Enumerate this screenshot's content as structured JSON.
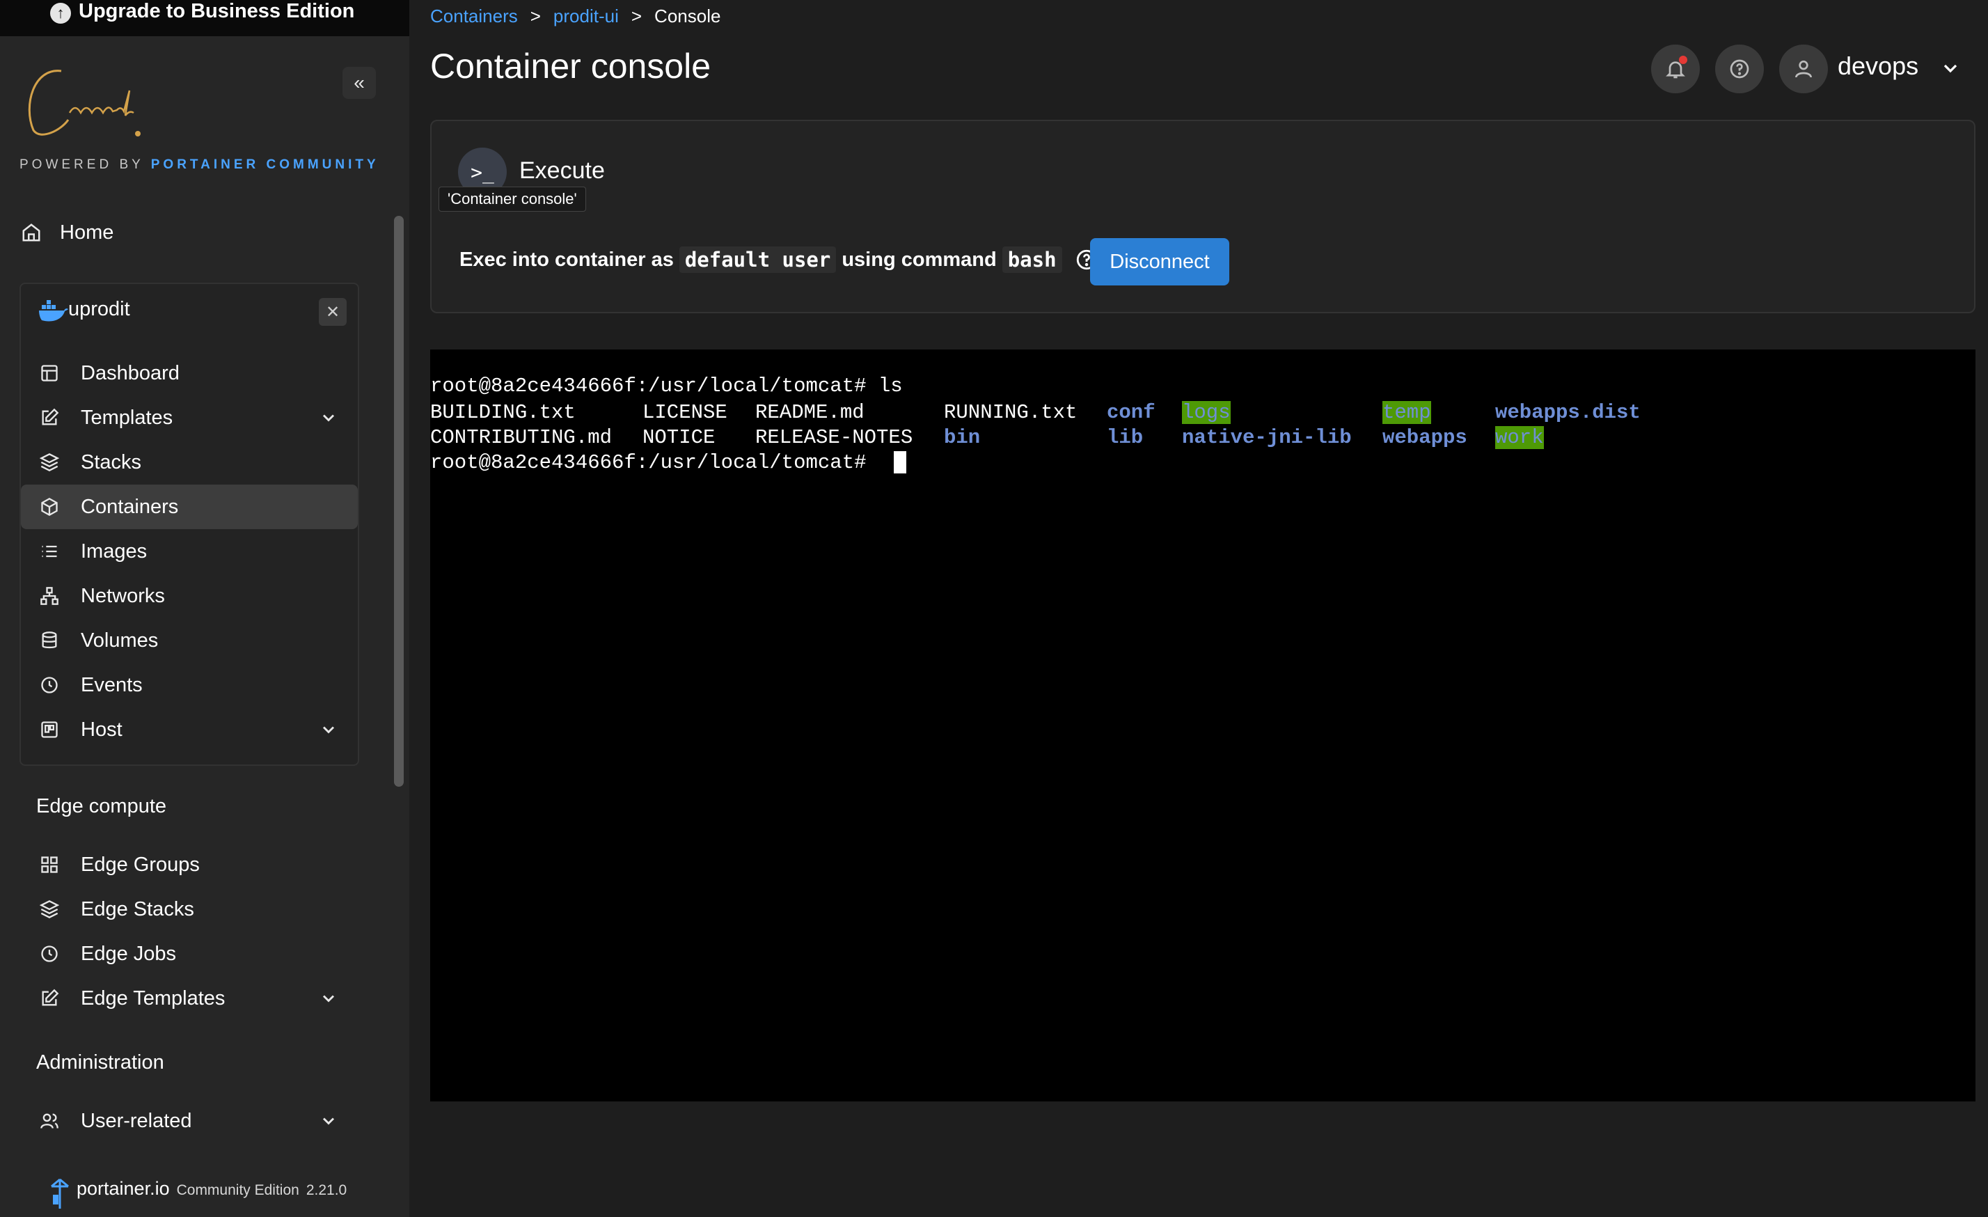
{
  "upgrade": {
    "label": "Upgrade to Business Edition"
  },
  "powered": {
    "prefix": "POWERED BY",
    "brand": "PORTAINER COMMUNITY"
  },
  "nav": {
    "home": "Home"
  },
  "environment": {
    "name": "uprodit",
    "items": [
      {
        "label": "Dashboard",
        "icon": "dashboard-icon"
      },
      {
        "label": "Templates",
        "icon": "edit-icon",
        "expandable": true
      },
      {
        "label": "Stacks",
        "icon": "layers-icon"
      },
      {
        "label": "Containers",
        "icon": "box-icon",
        "active": true
      },
      {
        "label": "Images",
        "icon": "list-icon"
      },
      {
        "label": "Networks",
        "icon": "network-icon"
      },
      {
        "label": "Volumes",
        "icon": "database-icon"
      },
      {
        "label": "Events",
        "icon": "clock-icon"
      },
      {
        "label": "Host",
        "icon": "host-icon",
        "expandable": true
      }
    ]
  },
  "edge": {
    "heading": "Edge compute",
    "items": [
      {
        "label": "Edge Groups",
        "icon": "grid-icon"
      },
      {
        "label": "Edge Stacks",
        "icon": "layers-icon"
      },
      {
        "label": "Edge Jobs",
        "icon": "clock-icon"
      },
      {
        "label": "Edge Templates",
        "icon": "edit-icon",
        "expandable": true
      }
    ]
  },
  "admin": {
    "heading": "Administration",
    "items": [
      {
        "label": "User-related",
        "icon": "users-icon",
        "expandable": true
      }
    ]
  },
  "footer": {
    "brand": "portainer.io",
    "edition": "Community Edition",
    "version": "2.21.0"
  },
  "breadcrumb": {
    "level1": "Containers",
    "level2": "prodit-ui",
    "current": "Console",
    "sep": ">"
  },
  "page": {
    "title": "Container console"
  },
  "user": {
    "name": "devops"
  },
  "execute": {
    "title": "Execute",
    "tooltip": "'Container console'",
    "prefix": "Exec into container as",
    "user_code": "default user",
    "middle": "using command",
    "command_code": "bash",
    "disconnect_label": "Disconnect"
  },
  "terminal": {
    "prompt1": "root@8a2ce434666f:/usr/local/tomcat# ls",
    "row1": [
      "BUILDING.txt",
      "LICENSE",
      "README.md",
      "RUNNING.txt",
      "conf",
      "logs",
      "temp",
      "webapps.dist"
    ],
    "row2": [
      "CONTRIBUTING.md",
      "NOTICE",
      "RELEASE-NOTES",
      "bin",
      "lib",
      "native-jni-lib",
      "webapps",
      "work"
    ],
    "prompt2": "root@8a2ce434666f:/usr/local/tomcat# "
  },
  "colors": {
    "accent": "#4aa3ff",
    "button": "#2b7fd4",
    "dir": "#6f8fd6",
    "highlight": "#4e9a06"
  }
}
